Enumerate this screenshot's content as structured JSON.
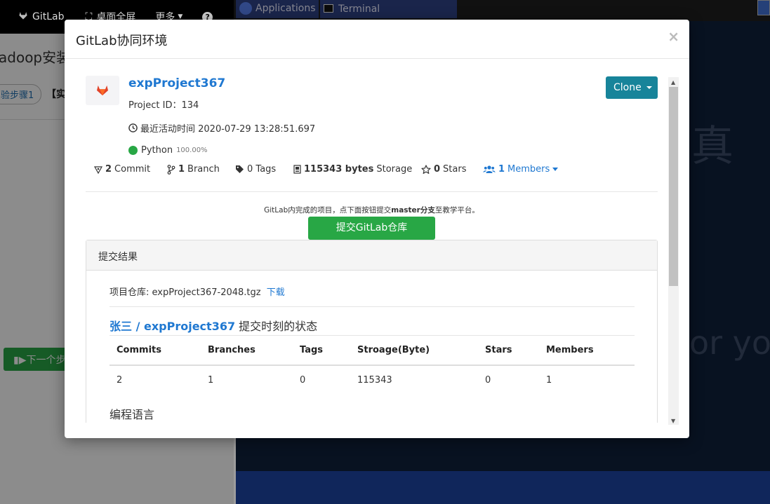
{
  "background": {
    "nav": {
      "brand": "GitLab",
      "fullscreen": "桌面全屏",
      "more": "更多"
    },
    "page_title": "adoop安装部",
    "step_badge": "验步骤1",
    "bracket": "【实",
    "next_button": "下一个步骤"
  },
  "vm": {
    "applications": "Applications",
    "terminal": "Terminal",
    "desktop_text_1": "真",
    "desktop_text_2": "or you"
  },
  "modal": {
    "title": "GitLab协同环境",
    "close": "×",
    "project": {
      "name": "expProject367",
      "id_label": "Project ID：134",
      "activity": "最近活动时间 2020-07-29 13:28:51.697",
      "language": "Python",
      "language_pct": "100.00%"
    },
    "clone_label": "Clone",
    "stats": {
      "commits_num": "2",
      "commits_label": "Commit",
      "branch_num": "1",
      "branch_label": "Branch",
      "tags_label": "0 Tags",
      "storage_num": "115343 bytes",
      "storage_label": "Storage",
      "stars_num": "0",
      "stars_label": "Stars",
      "members_num": "1",
      "members_label": "Members"
    },
    "notice_prefix": "GitLab内完成的项目，点下面按钮提交",
    "notice_bold": "master分支",
    "notice_suffix": "至教学平台。",
    "submit_label": "提交GitLab仓库",
    "panel": {
      "heading": "提交结果",
      "repo_label": "项目仓库: expProject367-2048.tgz",
      "download": "下载",
      "state_link": "张三 / expProject367",
      "state_suffix": " 提交时刻的状态",
      "columns": [
        "Commits",
        "Branches",
        "Tags",
        "Stroage(Byte)",
        "Stars",
        "Members"
      ],
      "row": [
        "2",
        "1",
        "0",
        "115343",
        "0",
        "1"
      ],
      "lang_heading": "编程语言"
    }
  },
  "colors": {
    "primary_link": "#1f78d1",
    "success": "#28a745",
    "clone": "#17849a"
  }
}
